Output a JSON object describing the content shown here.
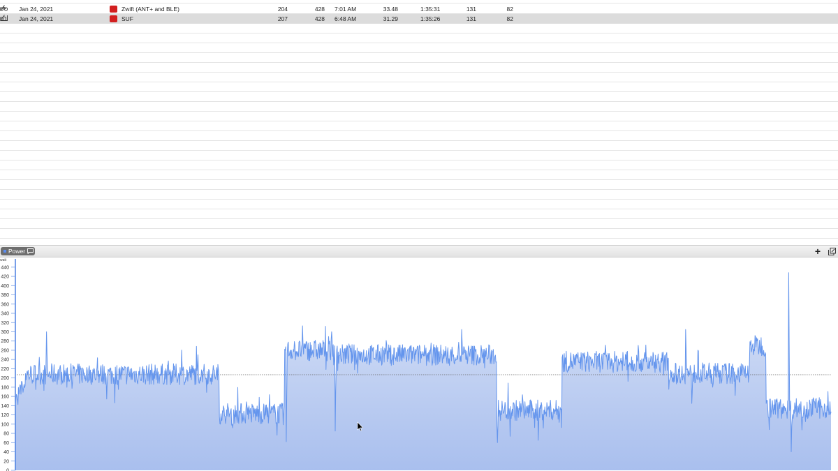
{
  "activities": [
    {
      "date": "Jan 24, 2021",
      "color": "#d21f1f",
      "name": "Zwift (ANT+ and BLE)",
      "tss": "204",
      "kj": "428",
      "start": "7:01 AM",
      "distance": "33.48",
      "duration": "1:35:31",
      "hr": "131",
      "cadence": "82",
      "selected": false
    },
    {
      "date": "Jan 24, 2021",
      "color": "#d21f1f",
      "name": "SUF",
      "tss": "207",
      "kj": "428",
      "start": "6:48 AM",
      "distance": "31.29",
      "duration": "1:35:26",
      "hr": "131",
      "cadence": "82",
      "selected": true
    }
  ],
  "chart_panel": {
    "tab_label": "Power",
    "add_label": "+",
    "colors": {
      "line": "#6495ed",
      "fill_top": "#dbe4f7",
      "fill_bottom": "#a9bfee",
      "accent": "#d21f1f"
    }
  },
  "chart_data": {
    "type": "area",
    "title": "",
    "ylabel": "watt",
    "ylim": [
      0,
      450
    ],
    "yticks": [
      0,
      20,
      40,
      60,
      80,
      100,
      120,
      140,
      160,
      180,
      200,
      220,
      240,
      260,
      280,
      300,
      320,
      340,
      360,
      380,
      400,
      420,
      440
    ],
    "average_line": 207,
    "x_unit": "fraction of ride",
    "segments": [
      {
        "x": [
          0.0,
          0.25
        ],
        "mean": 208
      },
      {
        "x": [
          0.25,
          0.33
        ],
        "mean": 123
      },
      {
        "x": [
          0.33,
          0.39
        ],
        "mean": 260
      },
      {
        "x": [
          0.39,
          0.59
        ],
        "mean": 250
      },
      {
        "x": [
          0.59,
          0.67
        ],
        "mean": 130
      },
      {
        "x": [
          0.67,
          0.8
        ],
        "mean": 235
      },
      {
        "x": [
          0.8,
          0.9
        ],
        "mean": 210
      },
      {
        "x": [
          0.9,
          0.92
        ],
        "mean": 270
      },
      {
        "x": [
          0.92,
          1.0
        ],
        "mean": 135
      }
    ],
    "markers": [
      {
        "x": 0.038,
        "y": 300
      },
      {
        "x": 0.23,
        "y": 215
      },
      {
        "x": 0.266,
        "y": 100
      },
      {
        "x": 0.332,
        "y": 62
      },
      {
        "x": 0.388,
        "y": 300
      },
      {
        "x": 0.392,
        "y": 85
      },
      {
        "x": 0.547,
        "y": 305
      },
      {
        "x": 0.591,
        "y": 60
      },
      {
        "x": 0.641,
        "y": 65
      },
      {
        "x": 0.822,
        "y": 305
      },
      {
        "x": 0.829,
        "y": 145
      },
      {
        "x": 0.948,
        "y": 428
      },
      {
        "x": 0.951,
        "y": 40
      },
      {
        "x": 0.984,
        "y": 145
      }
    ]
  }
}
